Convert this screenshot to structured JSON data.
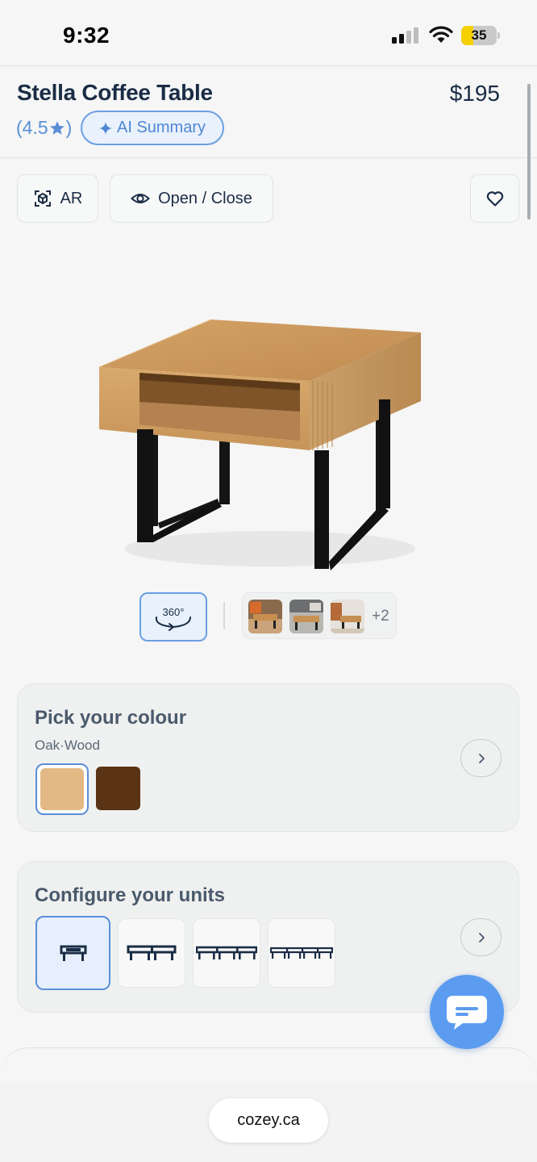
{
  "status_bar": {
    "time": "9:32",
    "battery_level": "35",
    "battery_fraction": 0.35
  },
  "header": {
    "title": "Stella Coffee Table",
    "price": "$195",
    "rating_open": "(4.5",
    "rating_close": ")",
    "ai_summary_label": "AI Summary"
  },
  "actions": {
    "ar_label": "AR",
    "open_close_label": "Open / Close"
  },
  "gallery": {
    "view_360_label": "360°",
    "more_count": "+2"
  },
  "colour": {
    "title": "Pick your colour",
    "selected_name": "Oak·Wood",
    "swatches": [
      {
        "name": "Oak",
        "color": "#e2b985"
      },
      {
        "name": "Walnut",
        "color": "#5a3415"
      }
    ]
  },
  "units": {
    "title": "Configure your units",
    "options": [
      "1",
      "2",
      "3",
      "4"
    ],
    "selected": "1"
  },
  "browser": {
    "url": "cozey.ca"
  },
  "colors": {
    "accent": "#5a8fd8",
    "brand_text": "#1a2c45",
    "chat": "#5b9cf0"
  }
}
